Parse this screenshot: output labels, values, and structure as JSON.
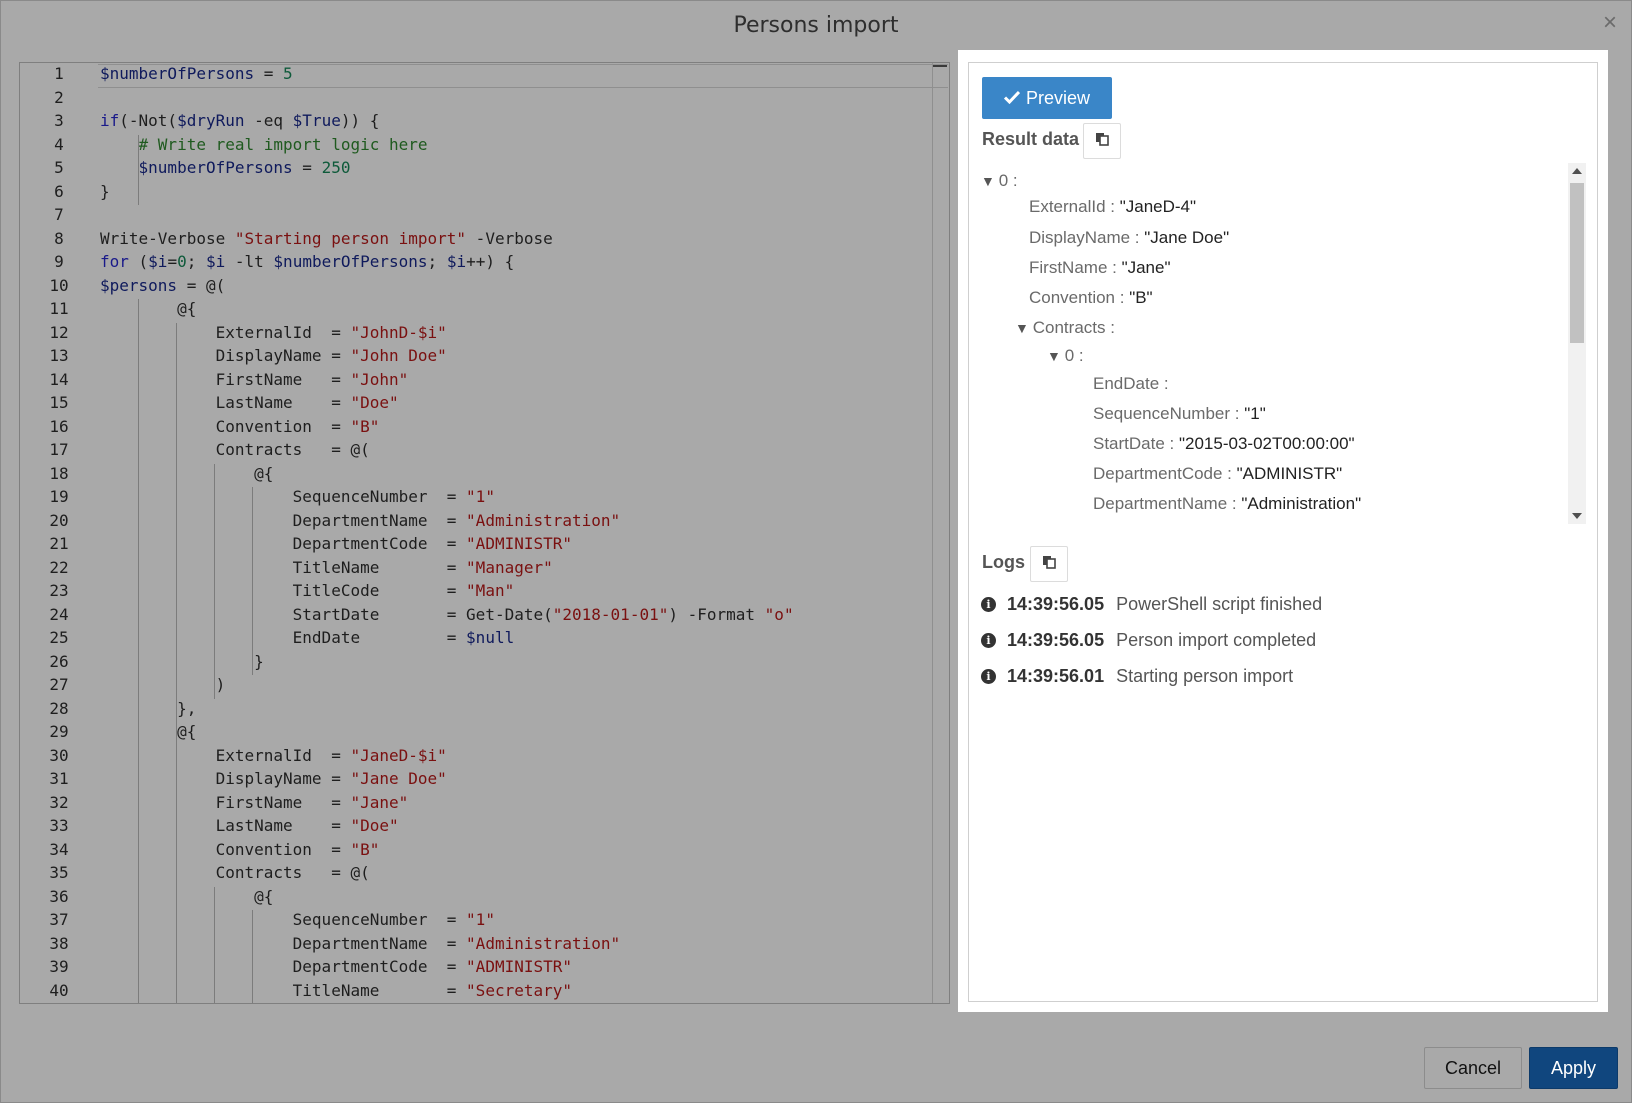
{
  "dialog": {
    "title": "Persons import",
    "close_label": "×",
    "cancel_label": "Cancel",
    "apply_label": "Apply"
  },
  "editor": {
    "lines": [
      [
        [
          "var",
          "$numberOfPersons"
        ],
        [
          "",
          " = "
        ],
        [
          "num",
          "5"
        ]
      ],
      [],
      [
        [
          "kw",
          "if"
        ],
        [
          "",
          "(-Not("
        ],
        [
          "var",
          "$dryRun"
        ],
        [
          "",
          " -eq "
        ],
        [
          "var",
          "$True"
        ],
        [
          "",
          "))"
        ],
        [
          "",
          " {"
        ]
      ],
      [
        [
          "",
          "    "
        ],
        [
          "com",
          "# Write real import logic here"
        ]
      ],
      [
        [
          "",
          "    "
        ],
        [
          "var",
          "$numberOfPersons"
        ],
        [
          "",
          " = "
        ],
        [
          "num",
          "250"
        ]
      ],
      [
        [
          "",
          "}"
        ]
      ],
      [],
      [
        [
          "",
          "Write-Verbose "
        ],
        [
          "str",
          "\"Starting person import\""
        ],
        [
          "",
          " -Verbose"
        ]
      ],
      [
        [
          "kw",
          "for"
        ],
        [
          "",
          " ("
        ],
        [
          "var",
          "$i"
        ],
        [
          "",
          "="
        ],
        [
          "num",
          "0"
        ],
        [
          "",
          "; "
        ],
        [
          "var",
          "$i"
        ],
        [
          "",
          " -lt "
        ],
        [
          "var",
          "$numberOfPersons"
        ],
        [
          "",
          "; "
        ],
        [
          "var",
          "$i"
        ],
        [
          "",
          "++) {"
        ]
      ],
      [
        [
          "var",
          "$persons"
        ],
        [
          "",
          " = @("
        ]
      ],
      [
        [
          "",
          "        @{"
        ]
      ],
      [
        [
          "",
          "            ExternalId  = "
        ],
        [
          "str",
          "\"JohnD-$i\""
        ]
      ],
      [
        [
          "",
          "            DisplayName = "
        ],
        [
          "str",
          "\"John Doe\""
        ]
      ],
      [
        [
          "",
          "            FirstName   = "
        ],
        [
          "str",
          "\"John\""
        ]
      ],
      [
        [
          "",
          "            LastName    = "
        ],
        [
          "str",
          "\"Doe\""
        ]
      ],
      [
        [
          "",
          "            Convention  = "
        ],
        [
          "str",
          "\"B\""
        ]
      ],
      [
        [
          "",
          "            Contracts   = @("
        ]
      ],
      [
        [
          "",
          "                @{"
        ]
      ],
      [
        [
          "",
          "                    SequenceNumber  = "
        ],
        [
          "str",
          "\"1\""
        ]
      ],
      [
        [
          "",
          "                    DepartmentName  = "
        ],
        [
          "str",
          "\"Administration\""
        ]
      ],
      [
        [
          "",
          "                    DepartmentCode  = "
        ],
        [
          "str",
          "\"ADMINISTR\""
        ]
      ],
      [
        [
          "",
          "                    TitleName       = "
        ],
        [
          "str",
          "\"Manager\""
        ]
      ],
      [
        [
          "",
          "                    TitleCode       = "
        ],
        [
          "str",
          "\"Man\""
        ]
      ],
      [
        [
          "",
          "                    StartDate       = Get-Date("
        ],
        [
          "str",
          "\"2018-01-01\""
        ],
        [
          "",
          ") -Format "
        ],
        [
          "str",
          "\"o\""
        ]
      ],
      [
        [
          "",
          "                    EndDate         = "
        ],
        [
          "var",
          "$null"
        ]
      ],
      [
        [
          "",
          "                }"
        ]
      ],
      [
        [
          "",
          "            )"
        ]
      ],
      [
        [
          "",
          "        },"
        ]
      ],
      [
        [
          "",
          "        @{"
        ]
      ],
      [
        [
          "",
          "            ExternalId  = "
        ],
        [
          "str",
          "\"JaneD-$i\""
        ]
      ],
      [
        [
          "",
          "            DisplayName = "
        ],
        [
          "str",
          "\"Jane Doe\""
        ]
      ],
      [
        [
          "",
          "            FirstName   = "
        ],
        [
          "str",
          "\"Jane\""
        ]
      ],
      [
        [
          "",
          "            LastName    = "
        ],
        [
          "str",
          "\"Doe\""
        ]
      ],
      [
        [
          "",
          "            Convention  = "
        ],
        [
          "str",
          "\"B\""
        ]
      ],
      [
        [
          "",
          "            Contracts   = @("
        ]
      ],
      [
        [
          "",
          "                @{"
        ]
      ],
      [
        [
          "",
          "                    SequenceNumber  = "
        ],
        [
          "str",
          "\"1\""
        ]
      ],
      [
        [
          "",
          "                    DepartmentName  = "
        ],
        [
          "str",
          "\"Administration\""
        ]
      ],
      [
        [
          "",
          "                    DepartmentCode  = "
        ],
        [
          "str",
          "\"ADMINISTR\""
        ]
      ],
      [
        [
          "",
          "                    TitleName       = "
        ],
        [
          "str",
          "\"Secretary\""
        ]
      ]
    ]
  },
  "preview": {
    "button_label": "Preview",
    "result_label": "Result data",
    "logs_label": "Logs"
  },
  "tree": [
    {
      "level": 0,
      "toggle": "▼",
      "key": "0 :",
      "value": ""
    },
    {
      "level": 1,
      "toggle": "",
      "key": "ExternalId :",
      "value": "\"JaneD-4\""
    },
    {
      "level": 1,
      "toggle": "",
      "key": "DisplayName :",
      "value": "\"Jane Doe\""
    },
    {
      "level": 1,
      "toggle": "",
      "key": "FirstName :",
      "value": "\"Jane\""
    },
    {
      "level": 1,
      "toggle": "",
      "key": "Convention :",
      "value": "\"B\""
    },
    {
      "level": 1,
      "toggle": "▼",
      "key": "Contracts :",
      "value": ""
    },
    {
      "level": 2,
      "toggle": "▼",
      "key": "0 :",
      "value": ""
    },
    {
      "level": 3,
      "toggle": "",
      "key": "EndDate :",
      "value": ""
    },
    {
      "level": 3,
      "toggle": "",
      "key": "SequenceNumber :",
      "value": "\"1\""
    },
    {
      "level": 3,
      "toggle": "",
      "key": "StartDate :",
      "value": "\"2015-03-02T00:00:00\""
    },
    {
      "level": 3,
      "toggle": "",
      "key": "DepartmentCode :",
      "value": "\"ADMINISTR\""
    },
    {
      "level": 3,
      "toggle": "",
      "key": "DepartmentName :",
      "value": "\"Administration\""
    }
  ],
  "logs": [
    {
      "time": "14:39:56.05",
      "message": "PowerShell script finished"
    },
    {
      "time": "14:39:56.05",
      "message": "Person import completed"
    },
    {
      "time": "14:39:56.01",
      "message": "Starting person import"
    }
  ]
}
